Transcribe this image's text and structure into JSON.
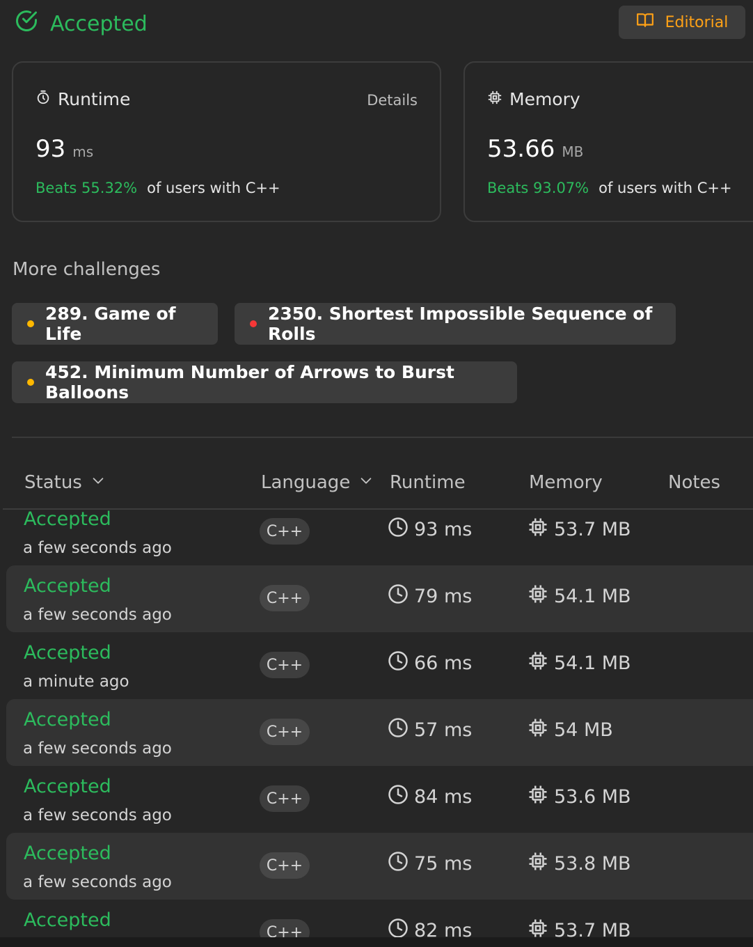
{
  "header": {
    "status": "Accepted",
    "editorial_label": "Editorial",
    "colors": {
      "accepted": "#2cbb5d",
      "editorial": "#ffa116"
    }
  },
  "runtime_card": {
    "title": "Runtime",
    "details_label": "Details",
    "value": "93",
    "unit": "ms",
    "beats": "Beats 55.32%",
    "suffix": "of users with C++"
  },
  "memory_card": {
    "title": "Memory",
    "value": "53.66",
    "unit": "MB",
    "beats": "Beats 93.07%",
    "suffix": "of users with C++"
  },
  "challenges": {
    "title": "More challenges",
    "items": [
      {
        "label": "289. Game of Life",
        "dot_color": "#ffb800"
      },
      {
        "label": "2350. Shortest Impossible Sequence of Rolls",
        "dot_color": "#f63737"
      },
      {
        "label": "452. Minimum Number of Arrows to Burst Balloons",
        "dot_color": "#ffb800"
      }
    ]
  },
  "table": {
    "headers": {
      "status": "Status",
      "language": "Language",
      "runtime": "Runtime",
      "memory": "Memory",
      "notes": "Notes"
    },
    "rows": [
      {
        "status": "Accepted",
        "time": "a few seconds ago",
        "lang": "C++",
        "runtime": "93 ms",
        "memory": "53.7 MB"
      },
      {
        "status": "Accepted",
        "time": "a few seconds ago",
        "lang": "C++",
        "runtime": "79 ms",
        "memory": "54.1 MB"
      },
      {
        "status": "Accepted",
        "time": "a minute ago",
        "lang": "C++",
        "runtime": "66 ms",
        "memory": "54.1 MB"
      },
      {
        "status": "Accepted",
        "time": "a few seconds ago",
        "lang": "C++",
        "runtime": "57 ms",
        "memory": "54 MB"
      },
      {
        "status": "Accepted",
        "time": "a few seconds ago",
        "lang": "C++",
        "runtime": "84 ms",
        "memory": "53.6 MB"
      },
      {
        "status": "Accepted",
        "time": "a few seconds ago",
        "lang": "C++",
        "runtime": "75 ms",
        "memory": "53.8 MB"
      },
      {
        "status": "Accepted",
        "time": "",
        "lang": "C++",
        "runtime": "82 ms",
        "memory": "53.7 MB"
      }
    ]
  }
}
